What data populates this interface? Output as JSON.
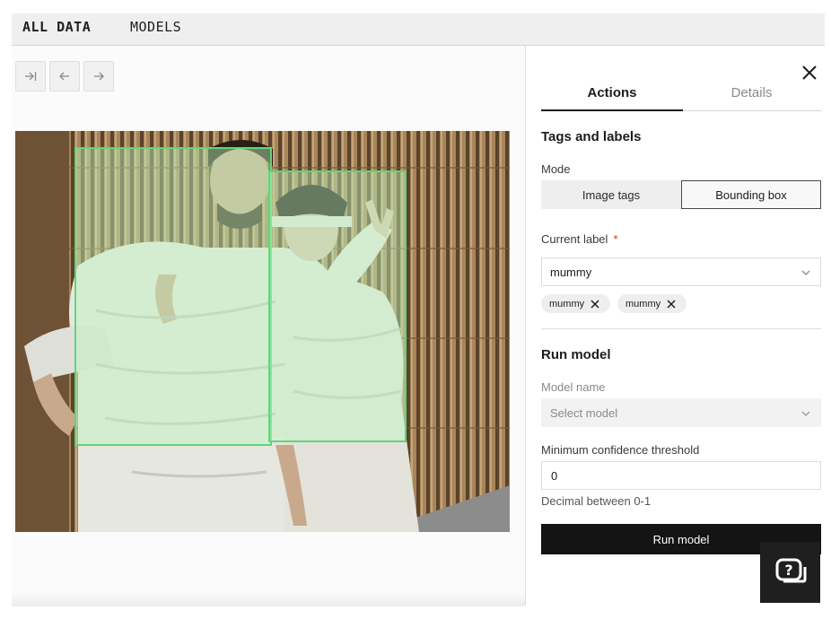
{
  "topbar": {
    "all_data": "ALL DATA",
    "models": "MODELS"
  },
  "toolbar": {
    "first_icon": "skip-to-end-icon",
    "prev_icon": "arrow-left-icon",
    "next_icon": "arrow-right-icon"
  },
  "image": {
    "box_color": "#5fd67a"
  },
  "panel": {
    "close_icon": "close-icon",
    "tabs": [
      {
        "label": "Actions",
        "active": true
      },
      {
        "label": "Details",
        "active": false
      }
    ],
    "tags_section": {
      "title": "Tags and labels",
      "mode_label": "Mode",
      "mode_options": [
        "Image tags",
        "Bounding box"
      ],
      "mode_selected": "Bounding box",
      "current_label_label": "Current label",
      "required_mark": "*",
      "current_label_value": "mummy",
      "chips": [
        "mummy",
        "mummy"
      ]
    },
    "model_section": {
      "title": "Run model",
      "model_name_label": "Model name",
      "model_placeholder": "Select model",
      "threshold_label": "Minimum confidence threshold",
      "threshold_value": "0",
      "threshold_help": "Decimal between 0-1",
      "run_button": "Run model"
    },
    "help_icon": "help-chat-icon"
  }
}
